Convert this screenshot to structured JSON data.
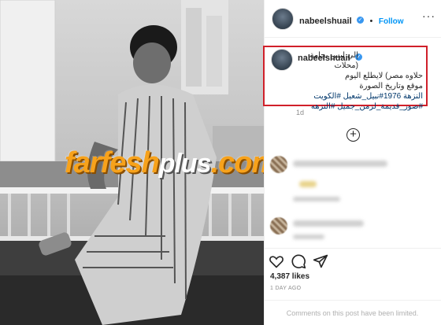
{
  "post": {
    "username": "nabeelshuail",
    "follow_label": "Follow",
    "separator": "•",
    "caption_lines": [
      "إلي لبس بجامة (محلات",
      "حلاوه مصر) لايطلع اليوم",
      "موقع وتاريخ الصورة",
      "النزهة 1976#نبيل_شعيل #الكويت",
      "#صور_قديمة_لزمن_جميل #النزهه"
    ],
    "caption_time": "1d",
    "likes": "4,387 likes",
    "date": "1 DAY AGO",
    "comments_limited": "Comments on this post have been limited."
  },
  "watermark": {
    "main": "farfesh",
    "plus": "plus",
    "suffix": ".com"
  },
  "colors": {
    "accent": "#0095f6",
    "highlight_box": "#d0202a",
    "watermark": "#f7a21b"
  },
  "icons": {
    "verified": "verified-badge-icon",
    "more": "more-options-icon",
    "add_comments": "plus-circle-icon",
    "like": "heart-icon",
    "comment": "comment-bubble-icon",
    "share": "paper-plane-icon"
  }
}
